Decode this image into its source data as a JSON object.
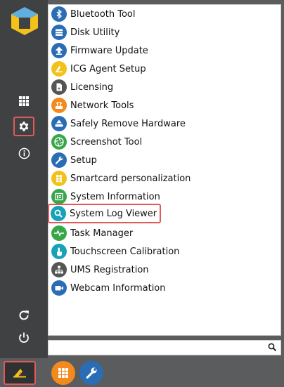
{
  "sidebar": {
    "logo_icon": "cube-logo-icon",
    "top_icons": [
      "apps-grid-icon",
      "settings-gear-icon",
      "info-icon"
    ],
    "bottom_icons": [
      "refresh-icon",
      "power-icon"
    ]
  },
  "menu": {
    "items": [
      {
        "label": "Bluetooth Tool",
        "icon": "bluetooth-icon",
        "color": "#2a6db5"
      },
      {
        "label": "Disk Utility",
        "icon": "disk-icon",
        "color": "#2a6db5"
      },
      {
        "label": "Firmware Update",
        "icon": "upload-arrow-icon",
        "color": "#2a6db5"
      },
      {
        "label": "ICG Agent Setup",
        "icon": "icg-agent-icon",
        "color": "#f2c21b"
      },
      {
        "label": "Licensing",
        "icon": "license-doc-icon",
        "color": "#555555"
      },
      {
        "label": "Network Tools",
        "icon": "network-tools-icon",
        "color": "#f28a1e"
      },
      {
        "label": "Safely Remove Hardware",
        "icon": "usb-drive-icon",
        "color": "#2a6db5"
      },
      {
        "label": "Screenshot Tool",
        "icon": "camera-aperture-icon",
        "color": "#3aa64a"
      },
      {
        "label": "Setup",
        "icon": "wrench-icon",
        "color": "#2a6db5"
      },
      {
        "label": "Smartcard personalization",
        "icon": "smartcard-icon",
        "color": "#f2c21b"
      },
      {
        "label": "System Information",
        "icon": "system-info-icon",
        "color": "#3aa64a"
      },
      {
        "label": "System Log Viewer",
        "icon": "magnifier-icon",
        "color": "#17a2b8"
      },
      {
        "label": "Task Manager",
        "icon": "heartbeat-icon",
        "color": "#3aa64a"
      },
      {
        "label": "Touchscreen Calibration",
        "icon": "touch-hand-icon",
        "color": "#17a2b8"
      },
      {
        "label": "UMS Registration",
        "icon": "network-tree-icon",
        "color": "#555555"
      },
      {
        "label": "Webcam Information",
        "icon": "video-camera-icon",
        "color": "#2a6db5"
      }
    ],
    "highlighted_item": "System Log Viewer"
  },
  "search": {
    "value": "",
    "placeholder": "",
    "icon": "search-icon"
  },
  "taskbar": {
    "start_icon": "igel-start-icon",
    "apps": [
      {
        "name": "application-launcher",
        "icon": "apps-grid-icon",
        "color": "#f28a1e"
      },
      {
        "name": "setup",
        "icon": "wrench-icon",
        "color": "#2a6db5"
      }
    ]
  },
  "colors": {
    "highlight": "#e05a5a",
    "sidebar_bg": "#3f4142",
    "menu_bg": "#ffffff"
  }
}
